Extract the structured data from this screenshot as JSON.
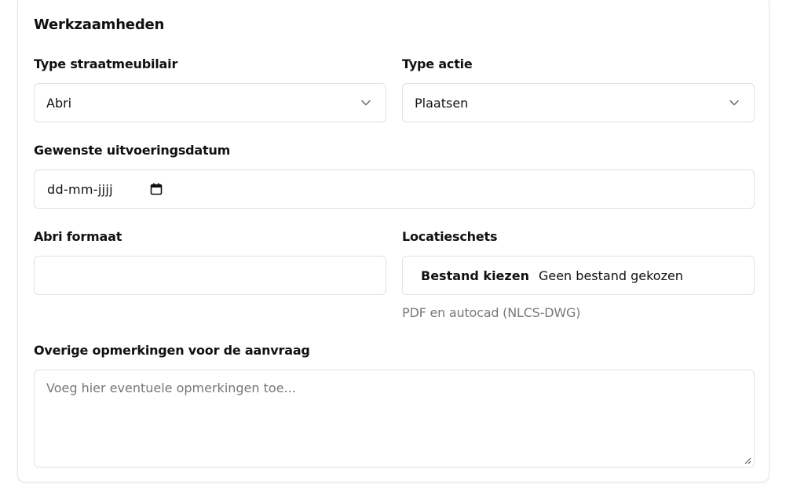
{
  "section": {
    "title": "Werkzaamheden"
  },
  "fields": {
    "type_straatmeubilair": {
      "label": "Type straatmeubilair",
      "value": "Abri"
    },
    "type_actie": {
      "label": "Type actie",
      "value": "Plaatsen"
    },
    "uitvoeringsdatum": {
      "label": "Gewenste uitvoeringsdatum",
      "placeholder": "dd-mm-jjjj"
    },
    "abri_formaat": {
      "label": "Abri formaat",
      "value": ""
    },
    "locatieschets": {
      "label": "Locatieschets",
      "button_label": "Bestand kiezen",
      "status": "Geen bestand gekozen",
      "hint": "PDF en autocad (NLCS-DWG)"
    },
    "opmerkingen": {
      "label": "Overige opmerkingen voor de aanvraag",
      "placeholder": "Voeg hier eventuele opmerkingen toe..."
    }
  },
  "icons": {
    "select_chevron": "chevron-down-icon",
    "date_picker": "calendar-icon",
    "textarea_resize": "resize-handle-icon"
  }
}
